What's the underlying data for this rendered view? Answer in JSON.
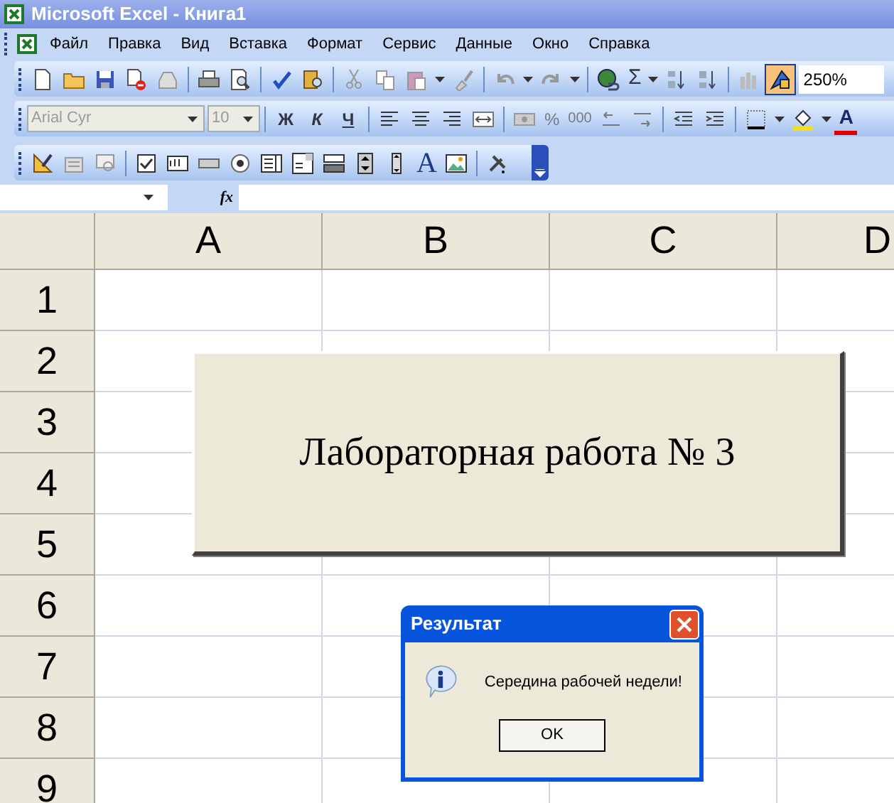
{
  "window": {
    "title": "Microsoft Excel - Книга1"
  },
  "menu": [
    {
      "label": "Файл"
    },
    {
      "label": "Правка"
    },
    {
      "label": "Вид"
    },
    {
      "label": "Вставка"
    },
    {
      "label": "Формат"
    },
    {
      "label": "Сервис"
    },
    {
      "label": "Данные"
    },
    {
      "label": "Окно"
    },
    {
      "label": "Справка"
    }
  ],
  "standard_toolbar": {
    "sum_label": "Σ",
    "drawing_on": true,
    "zoom": "250%"
  },
  "format_toolbar": {
    "disabled": true,
    "font": "Arial Cyr",
    "size": "10",
    "bold": "Ж",
    "italic": "К",
    "underline": "Ч",
    "percent": "%",
    "thousands": "000",
    "font_color": "A"
  },
  "forms_toolbar": {
    "label_tool": "A"
  },
  "formula_bar": {
    "fx": "fx"
  },
  "columns": [
    "A",
    "B",
    "C",
    "D"
  ],
  "rows": [
    "1",
    "2",
    "3",
    "4",
    "5",
    "6",
    "7",
    "8",
    "9"
  ],
  "sheet_button": {
    "label": "Лабораторная работа № 3"
  },
  "dialog": {
    "title": "Результат",
    "message": "Середина рабочей недели!",
    "button": "OK"
  }
}
